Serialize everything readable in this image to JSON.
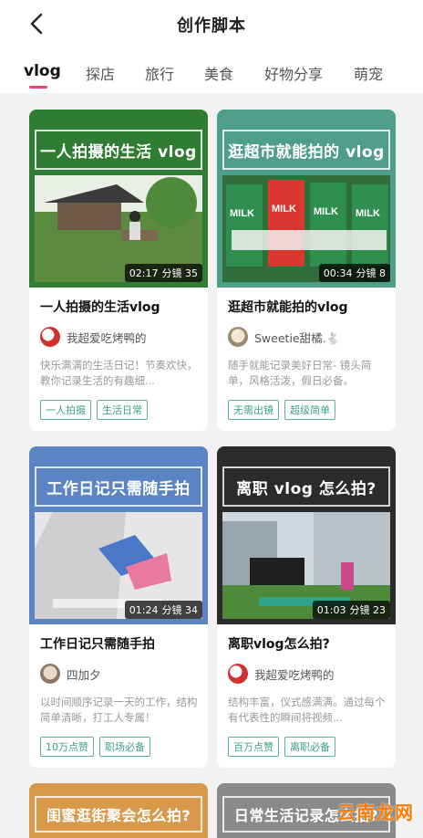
{
  "header": {
    "title": "创作脚本",
    "back_icon": "chevron-left-icon"
  },
  "tabs": [
    {
      "label": "vlog",
      "active": true
    },
    {
      "label": "探店"
    },
    {
      "label": "旅行"
    },
    {
      "label": "美食"
    },
    {
      "label": "好物分享"
    },
    {
      "label": "萌宠"
    }
  ],
  "cards": [
    {
      "thumb_title": "一人拍摄的生活 vlog",
      "duration": "02:17",
      "shots": "分镜 35",
      "title": "一人拍摄的生活vlog",
      "author": "我超爱吃烤鸭的",
      "desc": "快乐满满的生活日记！节奏欢快，教你记录生活的有趣细...",
      "tags": [
        "一人拍摄",
        "生活日常"
      ],
      "theme_color": "#2e7d32"
    },
    {
      "thumb_title": "逛超市就能拍的 vlog",
      "duration": "00:34",
      "shots": "分镜 8",
      "title": "逛超市就能拍的vlog",
      "author": "Sweetie甜橘.🐇",
      "desc": "随手就能记录美好日常- 镜头简单，风格活泼，假日必备。",
      "tags": [
        "无需出镜",
        "超级简单"
      ],
      "theme_color": "#4f9e8a",
      "photo_text": "MILK"
    },
    {
      "thumb_title": "工作日记只需随手拍",
      "duration": "01:24",
      "shots": "分镜 34",
      "title": "工作日记只需随手拍",
      "author": "四加夕",
      "desc": "以时间顺序记录一天的工作，结构简单清晰，打工人专属！",
      "tags": [
        "10万点赞",
        "职场必备"
      ],
      "theme_color": "#5b84c4"
    },
    {
      "thumb_title": "离职 vlog 怎么拍?",
      "duration": "01:03",
      "shots": "分镜 23",
      "title": "离职vlog怎么拍?",
      "author": "我超爱吃烤鸭的",
      "desc": "结构丰富，仪式感满满。通过每个有代表性的瞬间将视频...",
      "tags": [
        "百万点赞",
        "离职必备"
      ],
      "theme_color": "#2b2b2b"
    }
  ],
  "bottom_cards": [
    {
      "thumb_title": "闺蜜逛街聚会怎么拍?",
      "theme_color": "#d89a4a"
    },
    {
      "thumb_title": "日常生活记录怎么拍?",
      "theme_color": "#8a8a8a"
    }
  ],
  "watermark": "云南龙网"
}
